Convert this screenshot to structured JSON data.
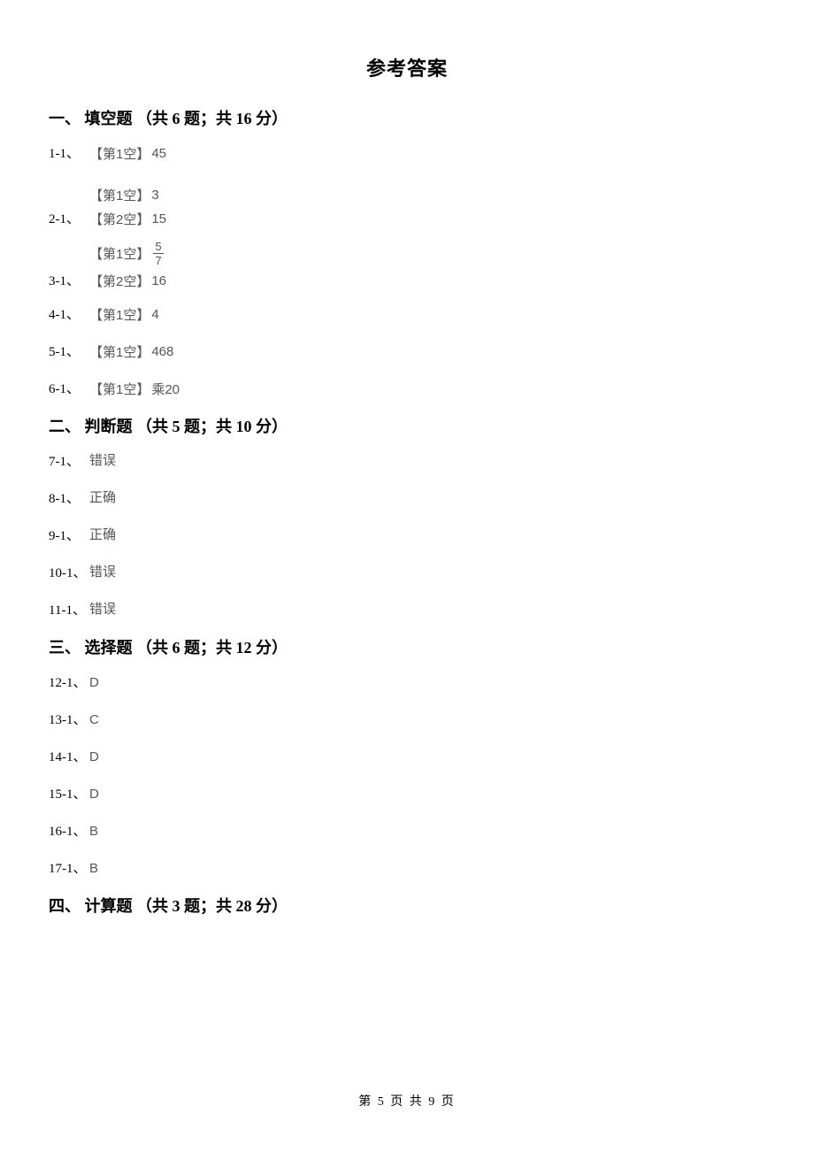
{
  "title": "参考答案",
  "sections": {
    "s1": {
      "num": "一、",
      "name": "填空题",
      "count_label": "（共 6 题；共 16 分）"
    },
    "s2": {
      "num": "二、",
      "name": "判断题",
      "count_label": "（共 5 题；共 10 分）"
    },
    "s3": {
      "num": "三、",
      "name": "选择题",
      "count_label": "（共 6 题；共 12 分）"
    },
    "s4": {
      "num": "四、",
      "name": "计算题",
      "count_label": "（共 3 题；共 28 分）"
    }
  },
  "blank_labels": {
    "b1": "【第1空】",
    "b2": "【第2空】"
  },
  "answers": {
    "q1_1": {
      "label": "1-1、",
      "a1": "45"
    },
    "q2_1": {
      "label": "2-1、",
      "a1": "3",
      "a2": "15"
    },
    "q3_1": {
      "label": "3-1、",
      "frac_num": "5",
      "frac_den": "7",
      "a2": "16"
    },
    "q4_1": {
      "label": "4-1、",
      "a1": "4"
    },
    "q5_1": {
      "label": "5-1、",
      "a1": "468"
    },
    "q6_1": {
      "label": "6-1、",
      "a1": "乘20"
    },
    "q7_1": {
      "label": "7-1、",
      "val": "错误"
    },
    "q8_1": {
      "label": "8-1、",
      "val": "正确"
    },
    "q9_1": {
      "label": "9-1、",
      "val": "正确"
    },
    "q10_1": {
      "label": "10-1、",
      "val": "错误"
    },
    "q11_1": {
      "label": "11-1、",
      "val": "错误"
    },
    "q12_1": {
      "label": "12-1、",
      "val": "D"
    },
    "q13_1": {
      "label": "13-1、",
      "val": "C"
    },
    "q14_1": {
      "label": "14-1、",
      "val": "D"
    },
    "q15_1": {
      "label": "15-1、",
      "val": "D"
    },
    "q16_1": {
      "label": "16-1、",
      "val": "B"
    },
    "q17_1": {
      "label": "17-1、",
      "val": "B"
    }
  },
  "footer": {
    "prefix": "第",
    "page": "5",
    "mid": "页 共",
    "total": "9",
    "suffix": "页"
  }
}
